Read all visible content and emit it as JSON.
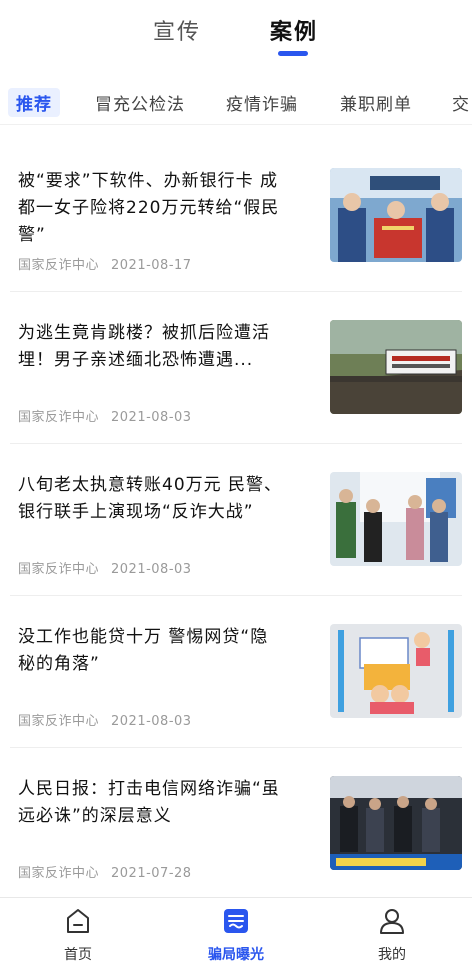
{
  "top_tabs": [
    "宣传",
    "案例"
  ],
  "categories": [
    "推荐",
    "冒充公检法",
    "疫情诈骗",
    "兼职刷单",
    "交"
  ],
  "articles": [
    {
      "title": "被“要求”下软件、办新银行卡 成都一女子险将220万元转给“假民警”",
      "source": "国家反诈中心",
      "date": "2021-08-17"
    },
    {
      "title": "为逃生竟肯跳楼？被抓后险遭活埋！男子亲述缅北恐怖遭遇...",
      "source": "国家反诈中心",
      "date": "2021-08-03"
    },
    {
      "title": "八旬老太执意转账40万元 民警、银行联手上演现场“反诈大战”",
      "source": "国家反诈中心",
      "date": "2021-08-03"
    },
    {
      "title": "没工作也能贷十万 警惕网贷“隐秘的角落”",
      "source": "国家反诈中心",
      "date": "2021-08-03"
    },
    {
      "title": "人民日报：打击电信网络诈骗“虽远必诛”的深层意义",
      "source": "国家反诈中心",
      "date": "2021-07-28"
    }
  ],
  "nav": {
    "home": "首页",
    "cases": "骗局曝光",
    "me": "我的"
  },
  "colors": {
    "accent": "#2a56ee"
  }
}
